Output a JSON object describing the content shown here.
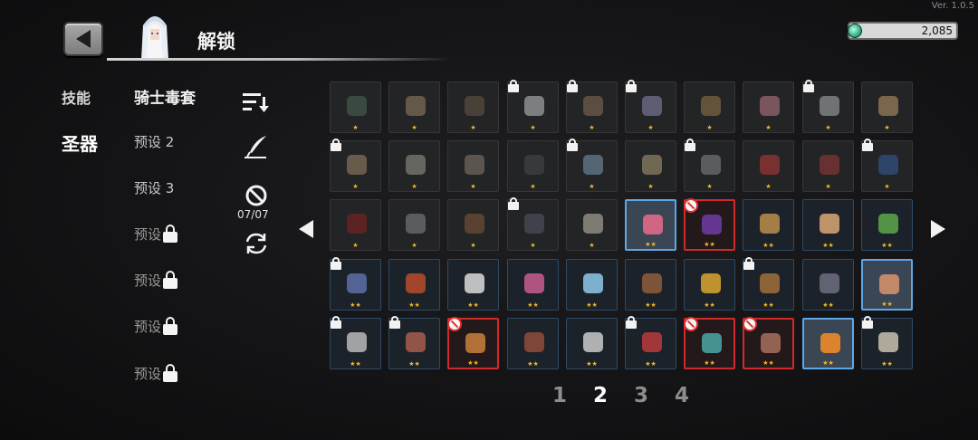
{
  "version": "Ver. 1.0.5",
  "header": {
    "title": "解锁",
    "back_icon": "back-arrow-icon",
    "avatar_icon": "character-portrait-icon"
  },
  "currency": {
    "amount": "2,085",
    "icon": "gem-icon",
    "color": "#2fae86"
  },
  "categories": [
    {
      "label": "技能",
      "active": false
    },
    {
      "label": "圣器",
      "active": true
    }
  ],
  "presets": [
    {
      "label": "骑士毒套",
      "locked": false
    },
    {
      "label": "预设 2",
      "locked": false
    },
    {
      "label": "预设 3",
      "locked": false
    },
    {
      "label": "预设",
      "locked": true
    },
    {
      "label": "预设",
      "locked": true
    },
    {
      "label": "预设",
      "locked": true
    },
    {
      "label": "预设",
      "locked": true
    }
  ],
  "tools": {
    "sort_icon": "sort-icon",
    "feather_icon": "quill-icon",
    "ban_icon": "ban-icon",
    "ban_count": "07/07",
    "refresh_icon": "refresh-icon"
  },
  "pagination": {
    "pages": [
      "1",
      "2",
      "3",
      "4"
    ],
    "current": "2",
    "prev_icon": "page-left-arrow-icon",
    "next_icon": "page-right-arrow-icon"
  },
  "colors": {
    "star": "#f1b62b",
    "ban_red": "#d12a2a",
    "selected_blue": "#5ea7e6"
  },
  "items": [
    {
      "stars": 1,
      "state": "normal",
      "lock": false,
      "color": "#4e6a55"
    },
    {
      "stars": 1,
      "state": "normal",
      "lock": false,
      "color": "#9a8466"
    },
    {
      "stars": 1,
      "state": "normal",
      "lock": false,
      "color": "#6a5a45"
    },
    {
      "stars": 1,
      "state": "normal",
      "lock": true,
      "color": "#c9c9c9"
    },
    {
      "stars": 1,
      "state": "normal",
      "lock": true,
      "color": "#8a6f55"
    },
    {
      "stars": 1,
      "state": "normal",
      "lock": true,
      "color": "#8e8ab0"
    },
    {
      "stars": 1,
      "state": "normal",
      "lock": false,
      "color": "#9b7a4d"
    },
    {
      "stars": 1,
      "state": "normal",
      "lock": false,
      "color": "#c27d8d"
    },
    {
      "stars": 1,
      "state": "normal",
      "lock": true,
      "color": "#b3b3b3"
    },
    {
      "stars": 1,
      "state": "normal",
      "lock": false,
      "color": "#c59a6a"
    },
    {
      "stars": 1,
      "state": "normal",
      "lock": true,
      "color": "#a08a6a"
    },
    {
      "stars": 1,
      "state": "normal",
      "lock": false,
      "color": "#9d9d8a"
    },
    {
      "stars": 1,
      "state": "normal",
      "lock": false,
      "color": "#8a7e6e"
    },
    {
      "stars": 1,
      "state": "normal",
      "lock": false,
      "color": "#4a4a4a"
    },
    {
      "stars": 1,
      "state": "normal",
      "lock": true,
      "color": "#7d9db5"
    },
    {
      "stars": 1,
      "state": "normal",
      "lock": false,
      "color": "#b3a07a"
    },
    {
      "stars": 1,
      "state": "normal",
      "lock": true,
      "color": "#8a8a8a"
    },
    {
      "stars": 1,
      "state": "normal",
      "lock": false,
      "color": "#c03a3a"
    },
    {
      "stars": 1,
      "state": "normal",
      "lock": false,
      "color": "#a03a3a"
    },
    {
      "stars": 1,
      "state": "normal",
      "lock": true,
      "color": "#3a5ea0"
    },
    {
      "stars": 1,
      "state": "normal",
      "lock": false,
      "color": "#8a2222"
    },
    {
      "stars": 1,
      "state": "normal",
      "lock": false,
      "color": "#8a8a8a"
    },
    {
      "stars": 1,
      "state": "normal",
      "lock": false,
      "color": "#8a5a3a"
    },
    {
      "stars": 1,
      "state": "normal",
      "lock": true,
      "color": "#5a5a6a"
    },
    {
      "stars": 1,
      "state": "normal",
      "lock": false,
      "color": "#c9c2b0"
    },
    {
      "stars": 2,
      "state": "selected",
      "lock": false,
      "color": "#e06a8a"
    },
    {
      "stars": 2,
      "state": "blocked",
      "lock": false,
      "color": "#6a3aa0"
    },
    {
      "stars": 2,
      "state": "tier2",
      "lock": false,
      "color": "#b08a4a"
    },
    {
      "stars": 2,
      "state": "tier2",
      "lock": false,
      "color": "#d0a070"
    },
    {
      "stars": 2,
      "state": "tier2",
      "lock": false,
      "color": "#5aa04a"
    },
    {
      "stars": 2,
      "state": "tier2",
      "lock": true,
      "color": "#5a6aa0"
    },
    {
      "stars": 2,
      "state": "tier2",
      "lock": false,
      "color": "#b04a2a"
    },
    {
      "stars": 2,
      "state": "tier2",
      "lock": false,
      "color": "#d0d0d0"
    },
    {
      "stars": 2,
      "state": "tier2",
      "lock": false,
      "color": "#c05a8a"
    },
    {
      "stars": 2,
      "state": "tier2",
      "lock": false,
      "color": "#8ac0e0"
    },
    {
      "stars": 2,
      "state": "tier2",
      "lock": false,
      "color": "#8a5a3a"
    },
    {
      "stars": 2,
      "state": "tier2",
      "lock": false,
      "color": "#d0a030"
    },
    {
      "stars": 2,
      "state": "tier2",
      "lock": true,
      "color": "#9a6a3a"
    },
    {
      "stars": 2,
      "state": "tier2",
      "lock": false,
      "color": "#6a6a7a"
    },
    {
      "stars": 2,
      "state": "selected",
      "lock": false,
      "color": "#d0906a"
    },
    {
      "stars": 2,
      "state": "tier2",
      "lock": true,
      "color": "#b0b0b0"
    },
    {
      "stars": 2,
      "state": "tier2",
      "lock": true,
      "color": "#a05a4a"
    },
    {
      "stars": 2,
      "state": "blocked",
      "lock": false,
      "color": "#c07a3a"
    },
    {
      "stars": 2,
      "state": "tier2",
      "lock": false,
      "color": "#8a4a3a"
    },
    {
      "stars": 2,
      "state": "tier2",
      "lock": false,
      "color": "#c0c0c0"
    },
    {
      "stars": 2,
      "state": "tier2",
      "lock": true,
      "color": "#b03a3a"
    },
    {
      "stars": 2,
      "state": "blocked",
      "lock": false,
      "color": "#4aa0a0"
    },
    {
      "stars": 2,
      "state": "blocked",
      "lock": false,
      "color": "#a06a5a"
    },
    {
      "stars": 2,
      "state": "selected",
      "lock": false,
      "color": "#f08a2a"
    },
    {
      "stars": 2,
      "state": "tier2",
      "lock": true,
      "color": "#c0b8a8"
    }
  ]
}
